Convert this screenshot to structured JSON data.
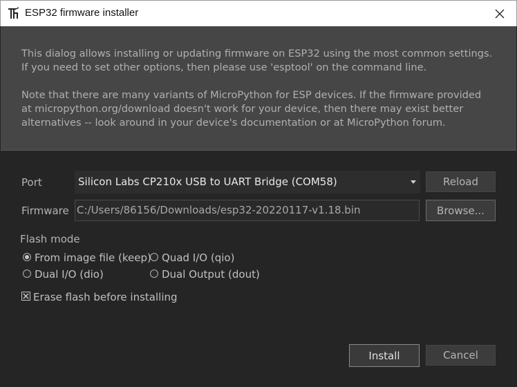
{
  "window": {
    "title": "ESP32 firmware installer",
    "close_icon": "close-icon",
    "app_icon": "thonny-icon"
  },
  "info": {
    "line1": "This dialog allows installing or updating firmware on ESP32 using the most common settings.",
    "line2": "If you need to set other options, then please use 'esptool' on the command line.",
    "line3": "Note that there are many variants of MicroPython for ESP devices. If the firmware provided",
    "line4": "at micropython.org/download doesn't work for your device, then there may exist better",
    "line5": "alternatives -- look around in your device's documentation or at MicroPython forum."
  },
  "port": {
    "label": "Port",
    "value": "Silicon Labs CP210x USB to UART Bridge (COM58)",
    "reload_label": "Reload"
  },
  "firmware": {
    "label": "Firmware",
    "value": "C:/Users/86156/Downloads/esp32-20220117-v1.18.bin",
    "browse_label": "Browse..."
  },
  "flash_mode": {
    "label": "Flash mode",
    "options": [
      {
        "label": "From image file (keep)",
        "checked": true
      },
      {
        "label": "Quad I/O (qio)",
        "checked": false
      },
      {
        "label": "Dual I/O (dio)",
        "checked": false
      },
      {
        "label": "Dual Output (dout)",
        "checked": false
      }
    ]
  },
  "erase": {
    "label": "Erase flash before installing",
    "checked": true
  },
  "actions": {
    "install_label": "Install",
    "cancel_label": "Cancel"
  },
  "colors": {
    "background": "#252526",
    "info_panel": "#464646",
    "button": "#3c3c3c"
  }
}
